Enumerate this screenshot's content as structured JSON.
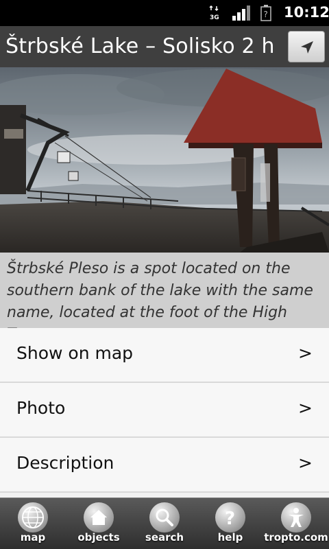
{
  "status_bar": {
    "network": "3G",
    "time": "10:12"
  },
  "header": {
    "title": "Štrbské Lake – Solisko  2 h",
    "nav_icon": "navigation-arrow-icon"
  },
  "photo": {
    "subject": "cable-car-and-wooden-shelter-photo"
  },
  "description": "Štrbské Pleso is a spot located on the southern bank of the lake with the same name, located at the foot of the High Tatras.",
  "menu": [
    {
      "label": "Show on map",
      "chevron": ">"
    },
    {
      "label": "Photo",
      "chevron": ">"
    },
    {
      "label": "Description",
      "chevron": ">"
    }
  ],
  "tabs": [
    {
      "label": "map",
      "icon": "globe-icon"
    },
    {
      "label": "objects",
      "icon": "house-icon"
    },
    {
      "label": "search",
      "icon": "magnifier-icon"
    },
    {
      "label": "help",
      "icon": "question-icon"
    },
    {
      "label": "tropto.com",
      "icon": "person-icon"
    }
  ]
}
